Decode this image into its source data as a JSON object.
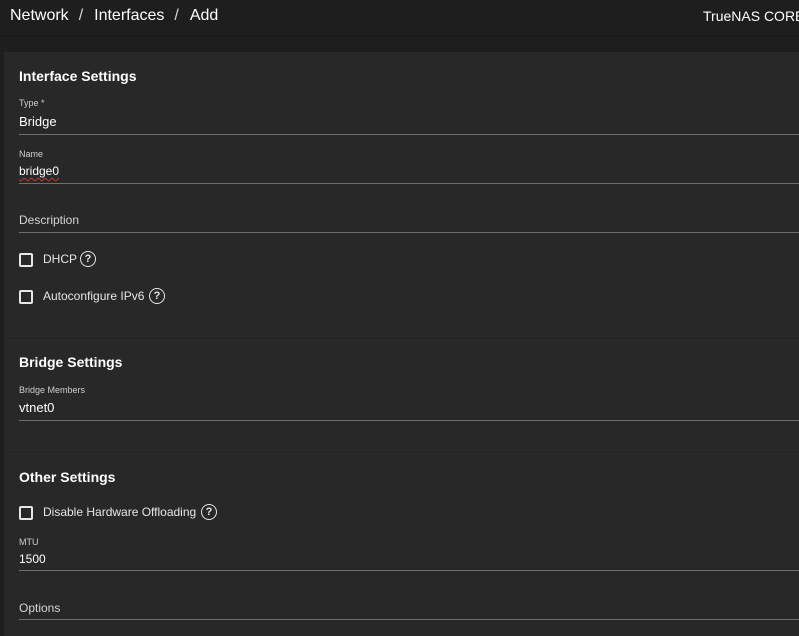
{
  "breadcrumb": {
    "items": [
      "Network",
      "Interfaces",
      "Add"
    ],
    "separator": "/"
  },
  "brand": "TrueNAS CORE®",
  "interface_settings": {
    "title": "Interface Settings",
    "type": {
      "label": "Type *",
      "value": "Bridge"
    },
    "name": {
      "label": "Name",
      "value": "bridge0"
    },
    "description": {
      "placeholder": "Description"
    },
    "dhcp": {
      "label": "DHCP",
      "checked": false
    },
    "autoconfig": {
      "label": "Autoconfigure IPv6",
      "checked": false
    }
  },
  "bridge_settings": {
    "title": "Bridge Settings",
    "members": {
      "label": "Bridge Members",
      "value": "vtnet0"
    }
  },
  "other_settings": {
    "title": "Other Settings",
    "disable_offloading": {
      "label": "Disable Hardware Offloading",
      "checked": false
    },
    "mtu": {
      "label": "MTU",
      "value": "1500"
    },
    "options": {
      "placeholder": "Options"
    }
  },
  "icons": {
    "help": "help-circle-icon",
    "help_glyph": "?"
  },
  "colors": {
    "background": "#1e1e1e",
    "card": "#282828",
    "text": "#ffffff",
    "underline": "#6f6f6f"
  }
}
